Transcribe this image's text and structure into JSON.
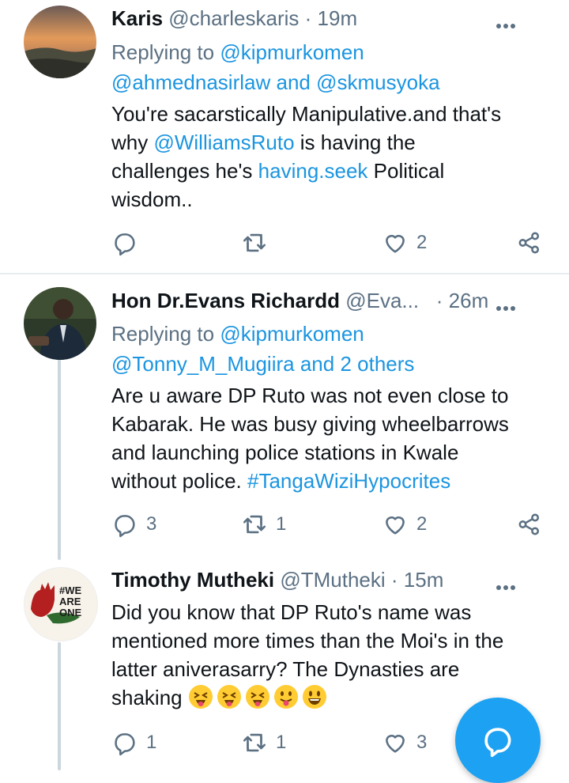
{
  "tweets": [
    {
      "name": "Karis",
      "handle": "@charleskaris",
      "time": "19m",
      "reply_prefix": "Replying to",
      "reply_to_1": "@kipmurkomen",
      "reply_to_2": "@ahmednasirlaw",
      "reply_and": "and",
      "reply_to_3": "@skmusyoka",
      "text_l1": "You're sacarstically Manipulative.and that's",
      "text_l2a": "why ",
      "text_l2_link": "@WilliamsRuto",
      "text_l2b": " is having the",
      "text_l3a": "challenges he's ",
      "text_l3_link": "having.seek",
      "text_l3b": " Political",
      "text_l4": "wisdom..",
      "replies": "",
      "retweets": "",
      "likes": "2"
    },
    {
      "name": "Hon Dr.Evans Richardd",
      "handle": "@Eva...",
      "time": "26m",
      "reply_prefix": "Replying to",
      "reply_to_1": "@kipmurkomen",
      "reply_to_2": "@Tonny_M_Mugiira",
      "reply_and": "and 2 others",
      "text_l1": "Are u aware DP Ruto was not even close to",
      "text_l2": "Kabarak. He was busy giving wheelbarrows",
      "text_l3": "and launching police stations in Kwale",
      "text_l4a": "without police. ",
      "text_l4_link": "#TangaWiziHypocrites",
      "replies": "3",
      "retweets": "1",
      "likes": "2"
    },
    {
      "name": "Timothy Mutheki",
      "handle": "@TMutheki",
      "time": "15m",
      "avatar_text": "#WE ARE ONE",
      "text_l1": "Did you know that DP Ruto's name was",
      "text_l2": "mentioned more times than the Moi's in the",
      "text_l3": "latter aniverasarry? The Dynasties are",
      "text_l4": "shaking",
      "replies": "1",
      "retweets": "1",
      "likes": "3"
    }
  ],
  "separator": "·",
  "colors": {
    "link": "#1b95e0",
    "muted": "#5b7083",
    "fab": "#1da1f2"
  },
  "icons": [
    "reply-icon",
    "retweet-icon",
    "like-icon",
    "share-icon",
    "more-icon",
    "compose-reply-icon"
  ]
}
